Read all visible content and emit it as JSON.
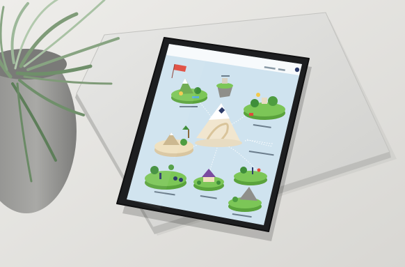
{
  "scene": {
    "description_colors": {
      "table": "#e4e3e0",
      "laptop": "#dcdcda",
      "tablet_frame": "#1d1e20",
      "tablet_screen_bg": "#cfe3ef",
      "grass": "#6fbf4a",
      "path": "#f3ead6",
      "pot": "#9e9e9c",
      "plant": "#6f8f6a"
    },
    "app": {
      "brand": "",
      "header_link_1": "",
      "header_link_2": "",
      "avatar_icon": "user-avatar-icon"
    },
    "islands": [
      {
        "name": "island-top-left",
        "label": ""
      },
      {
        "name": "island-top-center",
        "label": ""
      },
      {
        "name": "island-top-right",
        "label": ""
      },
      {
        "name": "island-center-mountain",
        "label": ""
      },
      {
        "name": "island-middle-left",
        "label": ""
      },
      {
        "name": "island-middle-right",
        "label": ""
      },
      {
        "name": "island-bottom-left",
        "label": ""
      },
      {
        "name": "island-bottom-center",
        "label": ""
      },
      {
        "name": "island-bottom-right",
        "label": ""
      }
    ]
  }
}
